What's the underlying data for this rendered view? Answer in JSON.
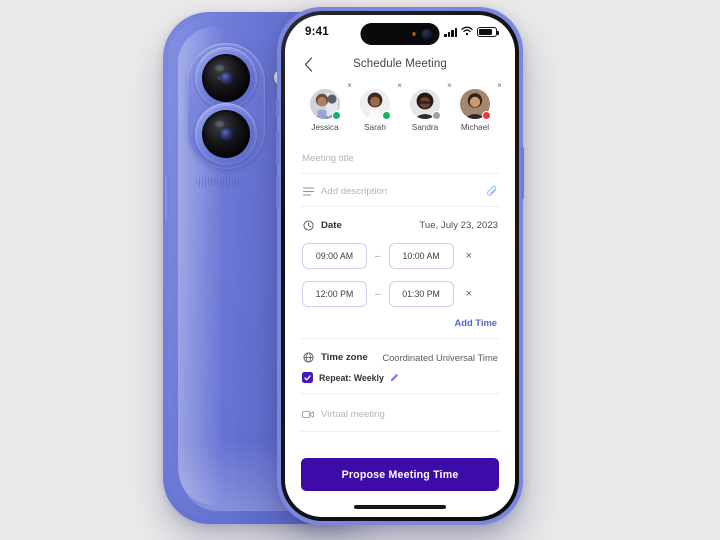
{
  "device": {
    "back_phone": {
      "body_color": "#626ecf",
      "camera_icon": "dual-camera-icon",
      "flash_icon": "flash-icon"
    },
    "front_phone": {
      "frame_color": "#111114",
      "body_color": "#7b86dd"
    }
  },
  "status_bar": {
    "time": "9:41",
    "signal_icon": "cellular-signal-icon",
    "wifi_icon": "wifi-icon",
    "battery_icon": "battery-icon"
  },
  "nav": {
    "back_icon": "chevron-left-icon",
    "title": "Schedule Meeting"
  },
  "participants": [
    {
      "name": "Jessica",
      "presence": "available",
      "presence_color": "#17b26a",
      "remove_label": "×"
    },
    {
      "name": "Sarah",
      "presence": "available",
      "presence_color": "#17b26a",
      "remove_label": "×"
    },
    {
      "name": "Sandra",
      "presence": "offline",
      "presence_color": "#9fa2ad",
      "remove_label": "×"
    },
    {
      "name": "Michael",
      "presence": "busy",
      "presence_color": "#e63946",
      "remove_label": "×"
    }
  ],
  "form": {
    "title_placeholder": "Meeting title",
    "title_value": "",
    "description_placeholder": "Add description",
    "description_value": "",
    "description_icon": "list-lines-icon",
    "attach_icon": "paperclip-icon",
    "date": {
      "icon": "clock-icon",
      "label": "Date",
      "value": "Tue, July 23, 2023"
    },
    "time_slots": [
      {
        "start": "09:00 AM",
        "separator": "–",
        "end": "10:00 AM",
        "remove_label": "×"
      },
      {
        "start": "12:00 PM",
        "separator": "–",
        "end": "01:30 PM",
        "remove_label": "×"
      }
    ],
    "add_time_label": "Add Time",
    "timezone": {
      "icon": "globe-icon",
      "label": "Time zone",
      "value": "Coordinated Universal Time"
    },
    "repeat": {
      "checked": true,
      "label": "Repeat: Weekly",
      "edit_icon": "pencil-icon",
      "checkbox_color": "#4b18b8"
    },
    "virtual_meeting": {
      "icon": "video-camera-icon",
      "placeholder": "Virtual meeting"
    }
  },
  "cta": {
    "label": "Propose Meeting Time",
    "color": "#3d0ca8"
  },
  "home_indicator": "home-indicator"
}
